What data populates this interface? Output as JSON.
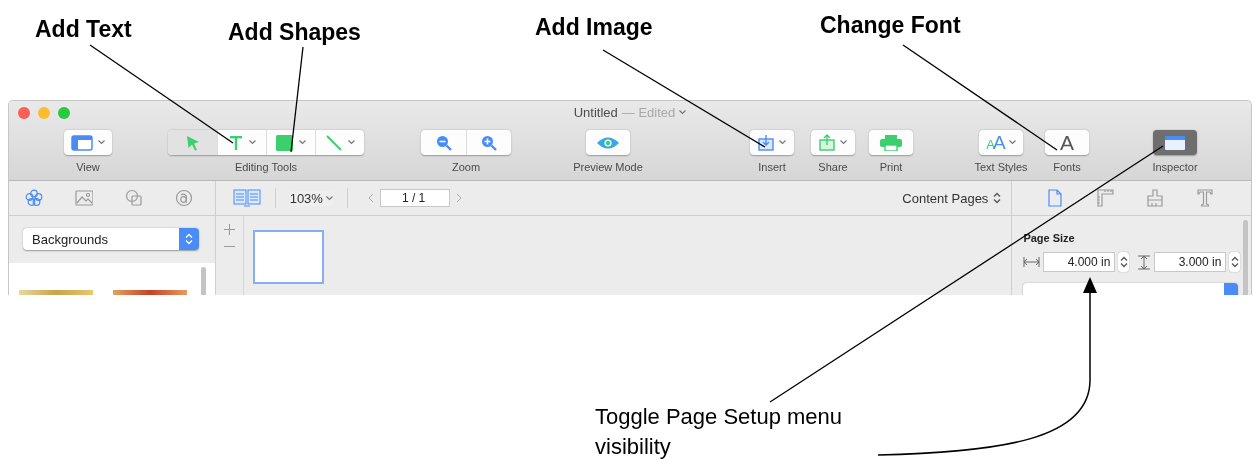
{
  "annotations": [
    {
      "text": "Add Text"
    },
    {
      "text": "Add Shapes"
    },
    {
      "text": "Add Image"
    },
    {
      "text": "Change Font"
    },
    {
      "text": "Toggle Page Setup menu visibility"
    }
  ],
  "window": {
    "title": "Untitled",
    "status": "— Edited"
  },
  "toolbar": [
    {
      "kind": "view",
      "label": "View"
    },
    {
      "kind": "editing",
      "label": "Editing Tools",
      "segments": [
        {
          "kind": "select",
          "selected": true
        },
        {
          "kind": "text",
          "selected": false
        },
        {
          "kind": "shape",
          "selected": false
        },
        {
          "kind": "line",
          "selected": false
        }
      ]
    },
    {
      "kind": "zoom",
      "label": "Zoom"
    },
    {
      "kind": "preview",
      "label": "Preview Mode"
    },
    {
      "kind": "insert",
      "label": "Insert"
    },
    {
      "kind": "share",
      "label": "Share"
    },
    {
      "kind": "print",
      "label": "Print"
    },
    {
      "kind": "text_styles",
      "label": "Text Styles",
      "glyph": "AA"
    },
    {
      "kind": "fonts",
      "label": "Fonts",
      "glyph": "A"
    },
    {
      "kind": "inspector",
      "label": "Inspector",
      "on": true
    }
  ],
  "library_tabs": [
    {
      "kind": "flower",
      "selected": true
    },
    {
      "kind": "picture",
      "selected": false
    },
    {
      "kind": "shapes",
      "selected": false
    },
    {
      "kind": "symbol",
      "selected": false
    }
  ],
  "view_bar": {
    "zoom": "103%",
    "page": "1 / 1",
    "page_set": "Content Pages"
  },
  "inspector_tabs": [
    {
      "kind": "page",
      "selected": true
    },
    {
      "kind": "ruler",
      "selected": false
    },
    {
      "kind": "brush",
      "selected": false
    },
    {
      "kind": "text",
      "selected": false
    }
  ],
  "sidebar": {
    "category": "Backgrounds"
  },
  "inspector": {
    "section": "Page Size",
    "width": "4.000 in",
    "height": "3.000 in"
  }
}
